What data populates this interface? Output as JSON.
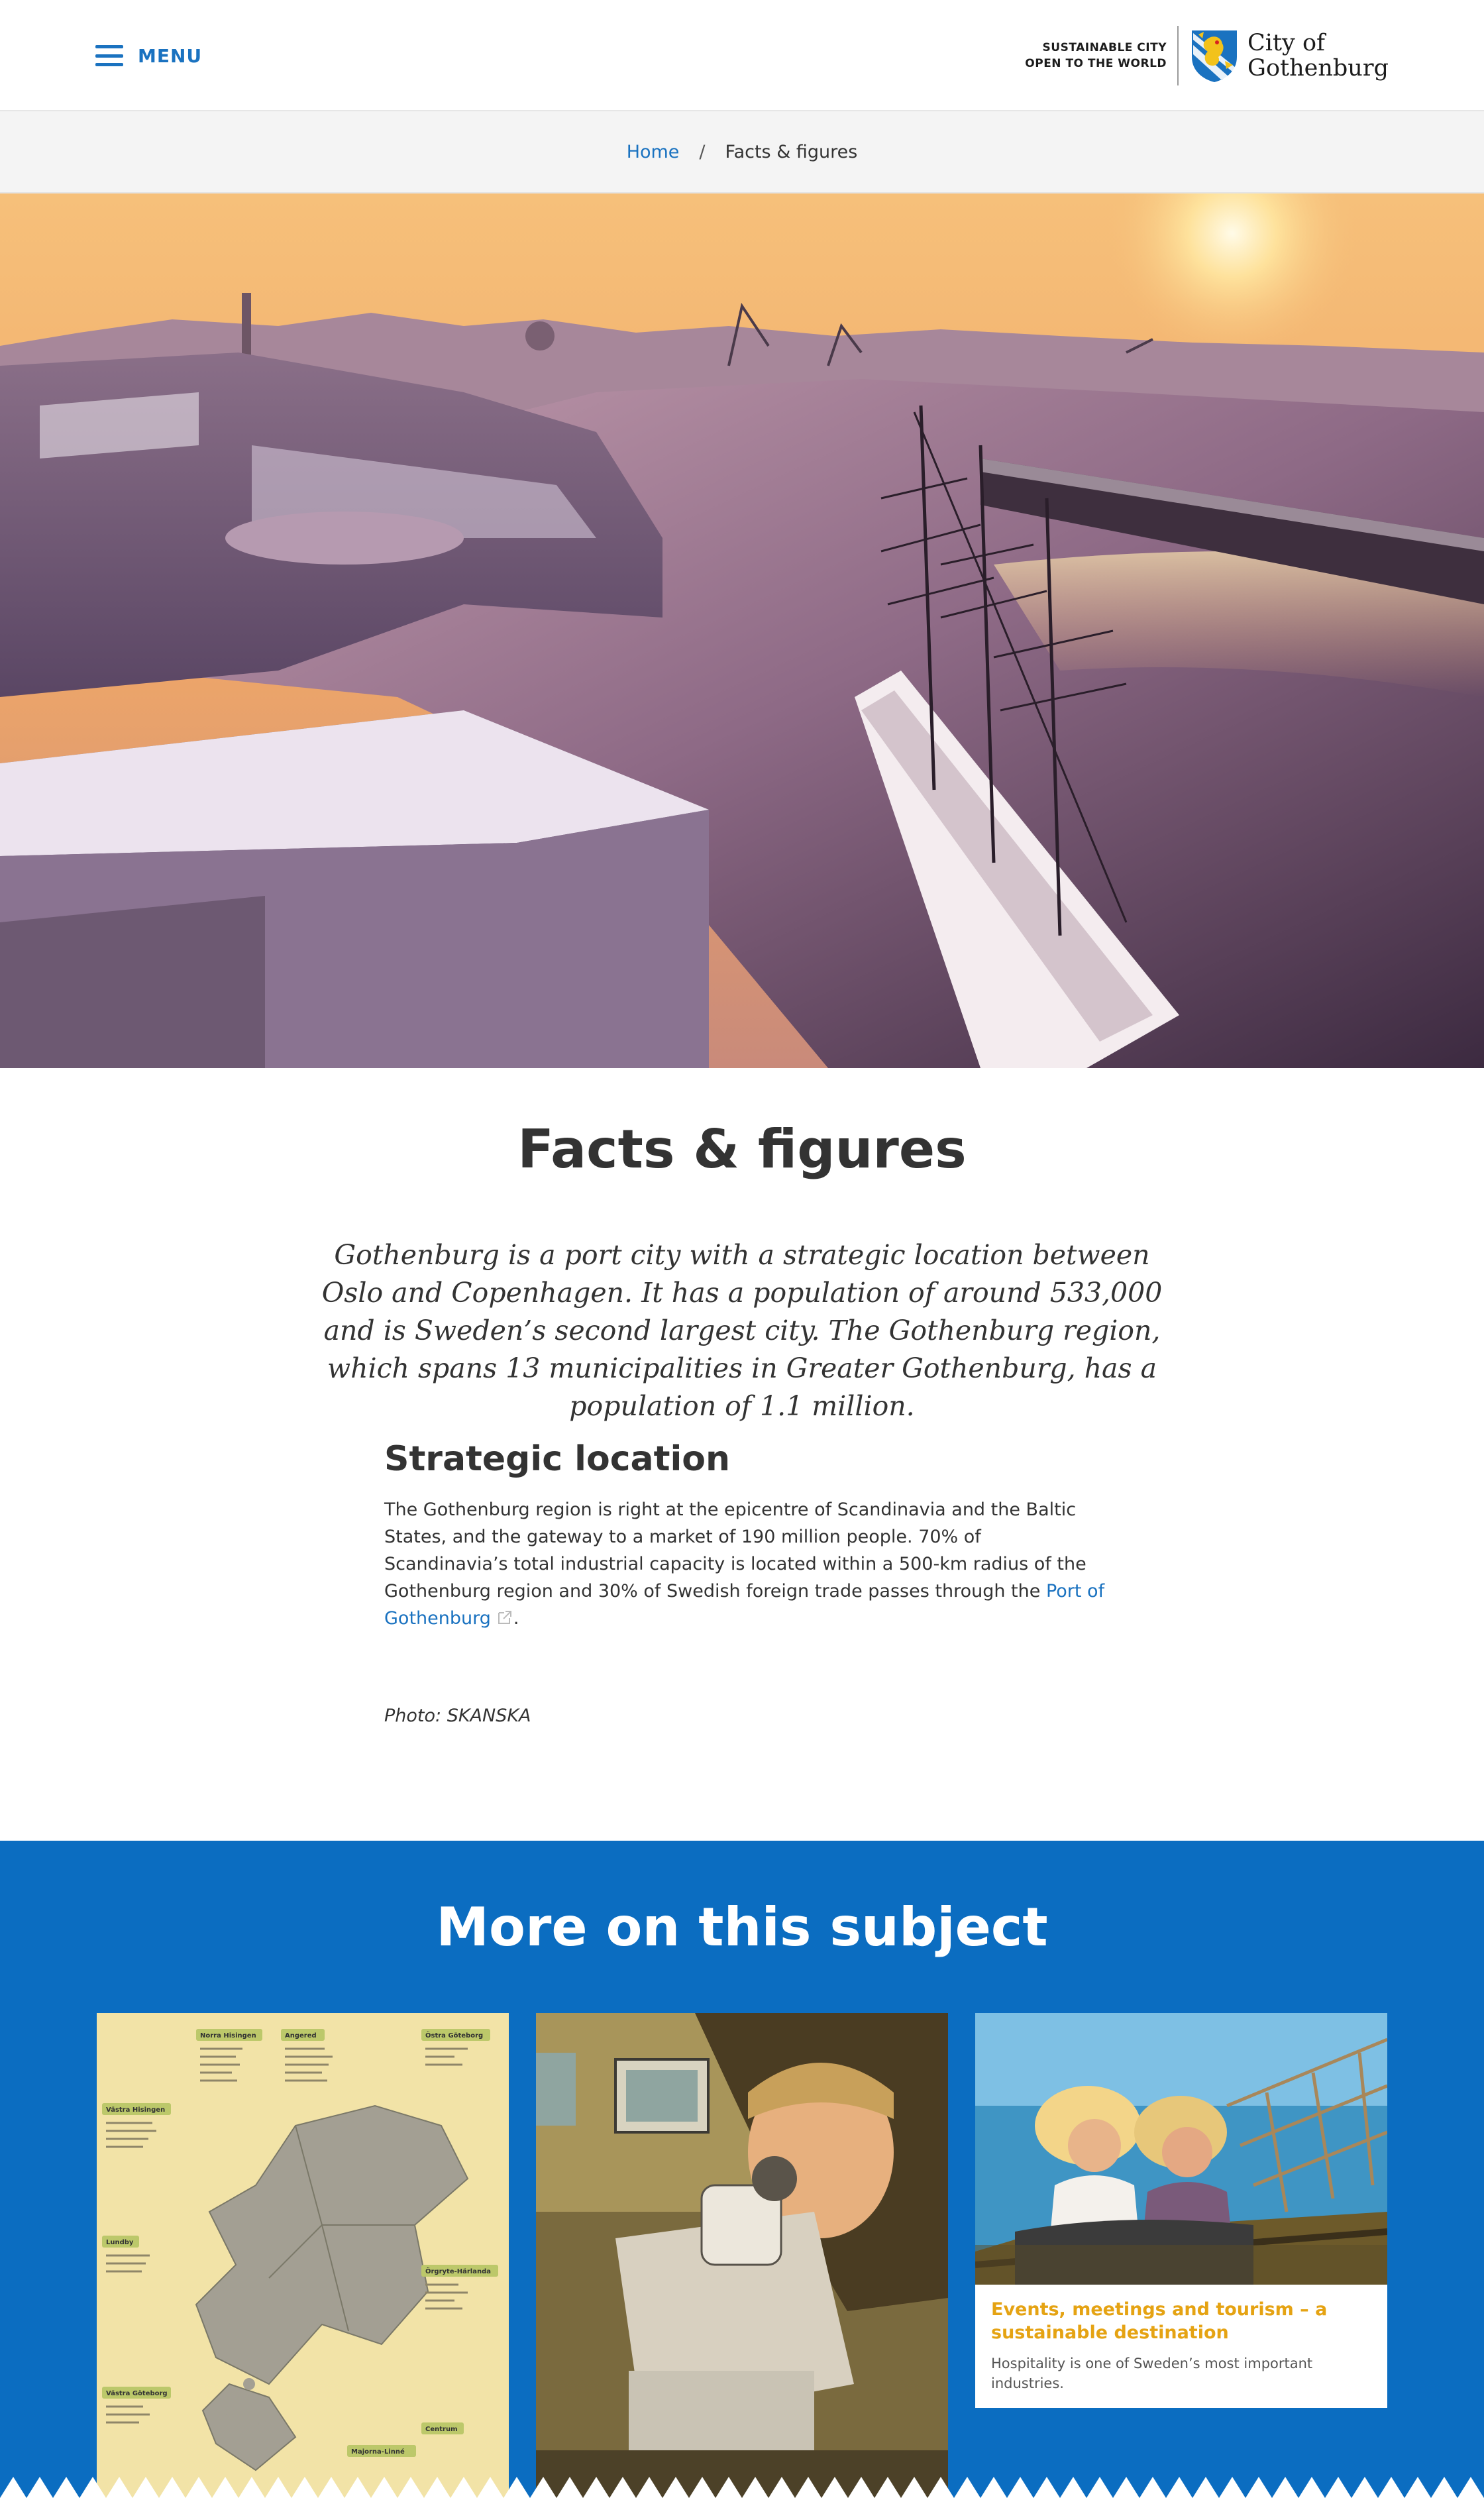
{
  "header": {
    "menu_label": "MENU",
    "tagline_line1": "SUSTAINABLE CITY",
    "tagline_line2": "OPEN TO THE WORLD",
    "logo_line1": "City of",
    "logo_line2": "Gothenburg"
  },
  "breadcrumb": {
    "home": "Home",
    "separator": "/",
    "current": "Facts & figures"
  },
  "main": {
    "title": "Facts & figures",
    "lead": "Gothenburg is a port city with a strategic location between Oslo and Copenhagen. It has a population of around 533,000 and is Sweden’s second largest city. The Gothenburg region, which spans 13 municipalities in Greater Gothenburg, has a population of 1.1 million.",
    "section_heading": "Strategic location",
    "body": "The Gothenburg region is right at the epicentre of Scandinavia and the Baltic States, and the gateway to a market of 190 million people. 70% of Scandinavia’s total industrial capacity is located within a 500-km radius of the Gothenburg region and 30% of Swedish foreign trade passes through the",
    "body_link": "Port of Gothenburg",
    "body_end": ".",
    "photo_credit": "Photo: SKANSKA"
  },
  "more": {
    "title": "More on this subject",
    "cards": [
      {
        "image": "district-map"
      },
      {
        "image": "microscope-lab"
      },
      {
        "image": "rollercoaster",
        "heading": "Events, meetings and tourism – a sustainable destination",
        "text": "Hospitality is one of Sweden’s most important industries."
      }
    ],
    "map_regions": [
      "Norra Hisingen",
      "Angered",
      "Östra Göteborg",
      "Västra Hisingen",
      "Lundby",
      "Örgryte-Härlanda",
      "Västra Göteborg",
      "Majorna-Linné",
      "Centrum"
    ]
  },
  "colors": {
    "brand_blue": "#1a72c0",
    "section_blue": "#0b6dc1",
    "card_heading": "#e5a313"
  }
}
